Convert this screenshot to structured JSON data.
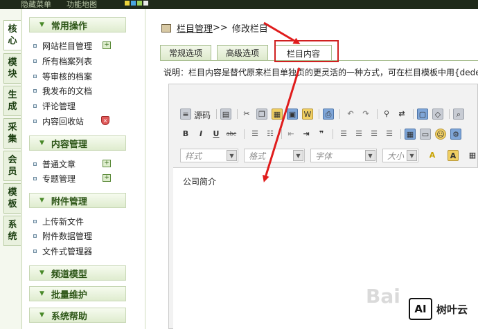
{
  "topbar": {
    "items": [
      "隐藏菜单",
      "功能地图"
    ]
  },
  "vtabs": [
    {
      "label": "核心",
      "active": true
    },
    {
      "label": "模块"
    },
    {
      "label": "生成"
    },
    {
      "label": "采集"
    },
    {
      "label": "会员"
    },
    {
      "label": "模板"
    },
    {
      "label": "系统"
    }
  ],
  "menu": {
    "groups": {
      "common": "常用操作",
      "content": "内容管理",
      "attach": "附件管理",
      "channel": "频道模型",
      "batch": "批量维护",
      "help": "系统帮助"
    },
    "items": {
      "site_cat": "网站栏目管理",
      "all_docs": "所有档案列表",
      "pending": "等审核的档案",
      "mine": "我发布的文档",
      "comments": "评论管理",
      "recycle": "内容回收站",
      "article": "普通文章",
      "topic": "专题管理",
      "upload": "上传新文件",
      "attach_data": "附件数据管理",
      "file_mgr": "文件式管理器"
    }
  },
  "breadcrumb": {
    "link": "栏目管理",
    "sep": ">>",
    "current": "修改栏目"
  },
  "tabs": [
    "常规选项",
    "高级选项",
    "栏目内容"
  ],
  "description": "说明：栏目内容是替代原来栏目单独页的更灵活的一种方式，可在栏目模板中用{dede",
  "editor": {
    "source_label": "源码",
    "style_placeholder": "样式",
    "format_placeholder": "格式",
    "font_placeholder": "字体",
    "size_placeholder": "大小",
    "content": "公司简介"
  },
  "watermark": {
    "logo_mark": "AI",
    "logo_name": "树叶云",
    "bg_text": "Bai"
  }
}
